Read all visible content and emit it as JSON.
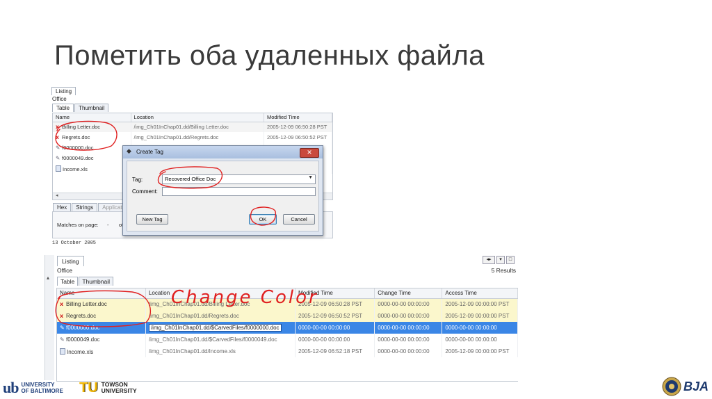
{
  "slide": {
    "title": "Пометить оба удаленных файла"
  },
  "top_panel": {
    "tab_listing": "Listing",
    "office_label": "Office",
    "tab_table": "Table",
    "tab_thumbnail": "Thumbnail",
    "columns": [
      "Name",
      "Location",
      "Modified Time"
    ],
    "rows": [
      {
        "icon": "deleted-x-icon",
        "name": "Billing Letter.doc",
        "location": "/img_Ch01InChap01.dd/Billing Letter.doc",
        "modified": "2005-12-09 06:50:28 PST"
      },
      {
        "icon": "deleted-x-icon",
        "name": "Regrets.doc",
        "location": "/img_Ch01InChap01.dd/Regrets.doc",
        "modified": "2005-12-09 06:50:52 PST"
      },
      {
        "icon": "pencil-icon",
        "name": "f0000000.doc",
        "location": "",
        "modified": ""
      },
      {
        "icon": "pencil-icon",
        "name": "f0000049.doc",
        "location": "",
        "modified": ""
      },
      {
        "icon": "file-icon",
        "name": "Income.xls",
        "location": "",
        "modified": ""
      }
    ],
    "bottom_tabs": [
      "Hex",
      "Strings",
      "Application"
    ],
    "matches_label": "Matches on page:",
    "matches_value": "-",
    "matches_of": "of",
    "date_text": "13 October 2005"
  },
  "dialog": {
    "title": "Create Tag",
    "close_glyph": "✕",
    "tag_label": "Tag:",
    "tag_value": "Recovered Office Doc",
    "comment_label": "Comment:",
    "comment_value": "",
    "new_tag_button": "New Tag",
    "ok_button": "OK",
    "cancel_button": "Cancel"
  },
  "bottom_panel": {
    "tab_listing": "Listing",
    "office_label": "Office",
    "results": "5 Results",
    "tab_table": "Table",
    "tab_thumbnail": "Thumbnail",
    "columns": [
      "Name",
      "Location",
      "Modified Time",
      "Change Time",
      "Access Time"
    ],
    "rows": [
      {
        "icon": "deleted-x-icon",
        "name": "Billing Letter.doc",
        "location": "/img_Ch01InChap01.dd/Billing Letter.doc",
        "modified": "2005-12-09 06:50:28 PST",
        "change": "0000-00-00 00:00:00",
        "access": "2005-12-09 00:00:00 PST",
        "style": "tagged"
      },
      {
        "icon": "deleted-x-icon",
        "name": "Regrets.doc",
        "location": "/img_Ch01InChap01.dd/Regrets.doc",
        "modified": "2005-12-09 06:50:52 PST",
        "change": "0000-00-00 00:00:00",
        "access": "2005-12-09 00:00:00 PST",
        "style": "tagged"
      },
      {
        "icon": "pencil-icon",
        "name": "f0000000.doc",
        "location": "/img_Ch01InChap01.dd/$CarvedFiles/f0000000.doc",
        "modified": "0000-00-00 00:00:00",
        "change": "0000-00-00 00:00:00",
        "access": "0000-00-00 00:00:00",
        "style": "selected"
      },
      {
        "icon": "pencil-icon",
        "name": "f0000049.doc",
        "location": "/img_Ch01InChap01.dd/$CarvedFiles/f0000049.doc",
        "modified": "0000-00-00 00:00:00",
        "change": "0000-00-00 00:00:00",
        "access": "0000-00-00 00:00:00",
        "style": "normal"
      },
      {
        "icon": "file-icon",
        "name": "Income.xls",
        "location": "/img_Ch01InChap01.dd/Income.xls",
        "modified": "2005-12-09 06:52:18 PST",
        "change": "0000-00-00 00:00:00",
        "access": "2005-12-09 00:00:00 PST",
        "style": "normal"
      }
    ]
  },
  "annotation": {
    "text": "Change Color",
    "color": "#e02020"
  },
  "footer": {
    "ub_mark": "ub",
    "ub_line1": "UNIVERSITY",
    "ub_line2": "OF BALTIMORE",
    "tu_mark": "TU",
    "tu_line1": "TOWSON",
    "tu_line2": "UNIVERSITY",
    "bja_text": "BJA"
  },
  "colors": {
    "tagged_row": "#fbf7cc",
    "selected_row": "#3a86e6",
    "ink": "#e02020"
  }
}
